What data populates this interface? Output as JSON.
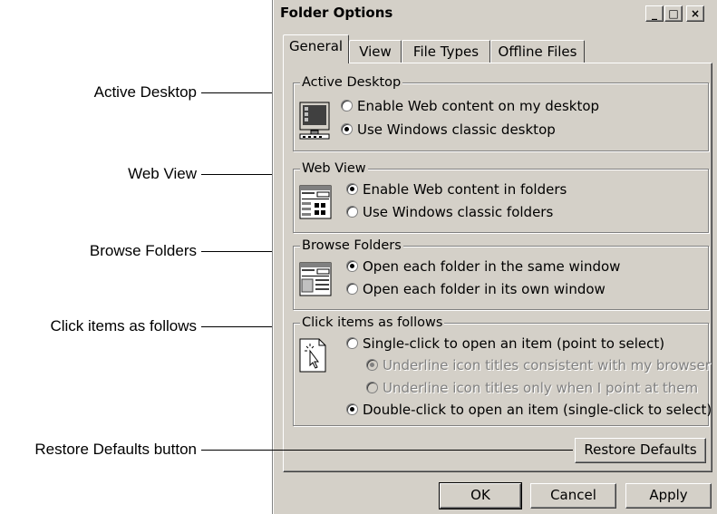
{
  "callouts": {
    "active_desktop": "Active Desktop",
    "web_view": "Web View",
    "browse_folders": "Browse Folders",
    "click_items": "Click items as follows",
    "restore_defaults": "Restore Defaults button"
  },
  "window": {
    "title": "Folder Options",
    "minimize": "_",
    "maximize": "□",
    "close": "×"
  },
  "tabs": [
    "General",
    "View",
    "File Types",
    "Offline Files"
  ],
  "groups": {
    "active_desktop": {
      "legend": "Active Desktop",
      "options": [
        "Enable Web content on my desktop",
        "Use Windows classic desktop"
      ]
    },
    "web_view": {
      "legend": "Web View",
      "options": [
        "Enable Web content in folders",
        "Use Windows classic folders"
      ]
    },
    "browse_folders": {
      "legend": "Browse Folders",
      "options": [
        "Open each folder in the same window",
        "Open each folder in its own window"
      ]
    },
    "click_items": {
      "legend": "Click items as follows",
      "single": "Single-click to open an item (point to select)",
      "sub1": "Underline icon titles consistent with my browser",
      "sub2": "Underline icon titles only when I point at them",
      "double": "Double-click to open an item (single-click to select)"
    }
  },
  "buttons": {
    "restore": "Restore Defaults",
    "ok": "OK",
    "cancel": "Cancel",
    "apply": "Apply"
  },
  "icons": {
    "active_desktop": "monitor-icon",
    "web_view": "web-folder-icon",
    "browse_folders": "browse-window-icon",
    "click_items": "pointer-click-icon"
  }
}
